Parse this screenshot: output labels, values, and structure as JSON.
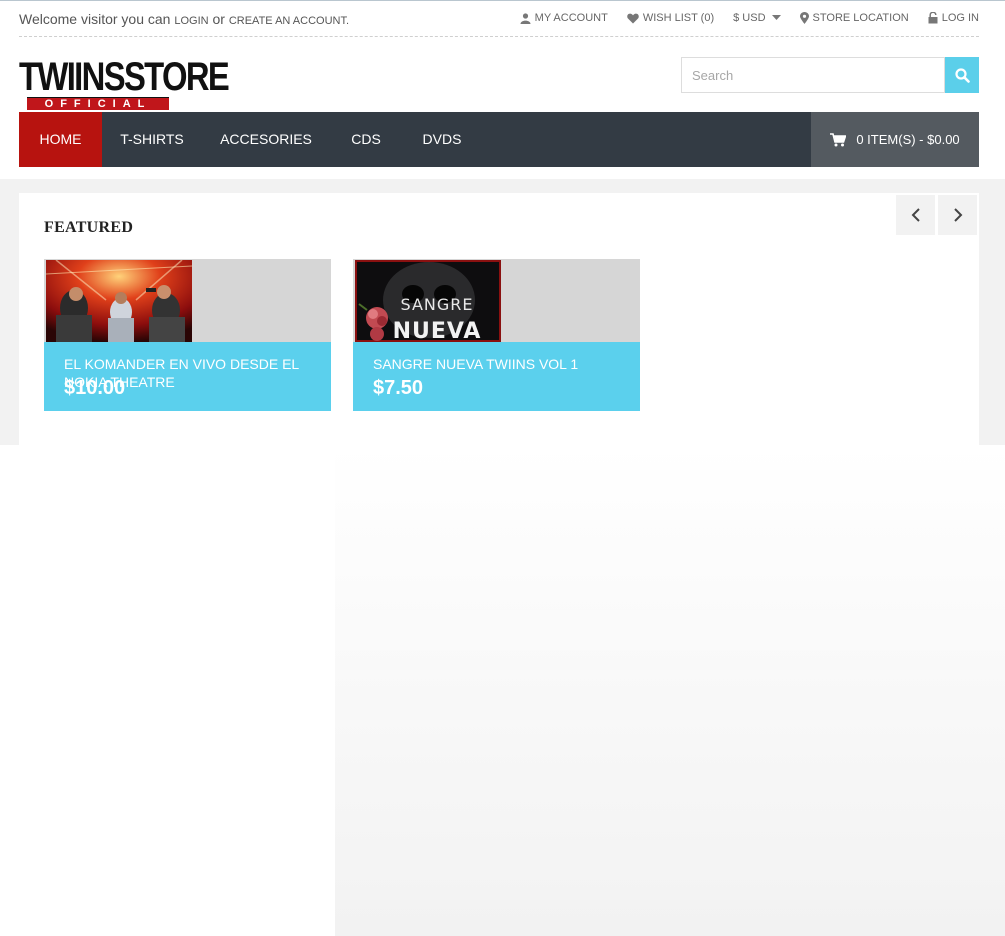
{
  "topbar": {
    "welcome_text": "Welcome visitor you can",
    "login_label": "login",
    "or_text": "or",
    "create_account_label": "create an account.",
    "my_account_label": "MY ACCOUNT",
    "wishlist_label": "WISH LIST (0)",
    "currency_label": "$ USD",
    "store_location_label": "STORE LOCATION",
    "login_right_label": "LOG IN"
  },
  "logo": {
    "main_text": "TWIINSSTORE",
    "sub_text": "OFFICIAL"
  },
  "search": {
    "placeholder": "Search",
    "value": ""
  },
  "nav": {
    "items": [
      {
        "label": "HOME",
        "active": true
      },
      {
        "label": "T-SHIRTS",
        "active": false
      },
      {
        "label": "ACCESORIES",
        "active": false
      },
      {
        "label": "CDS",
        "active": false
      },
      {
        "label": "DVDS",
        "active": false
      }
    ],
    "cart_label": "0 ITEM(S) - $0.00"
  },
  "featured": {
    "title": "FEATURED",
    "products": [
      {
        "name": "EL KOMANDER EN VIVO DESDE EL NOKIA THEATRE",
        "price": "$10.00"
      },
      {
        "name": "SANGRE NUEVA TWIINS VOL 1",
        "price": "$7.50"
      }
    ]
  },
  "colors": {
    "accent": "#5bd0ed",
    "nav_bg": "#333b44",
    "nav_active": "#b7130f",
    "cart_bg": "#545a60"
  }
}
